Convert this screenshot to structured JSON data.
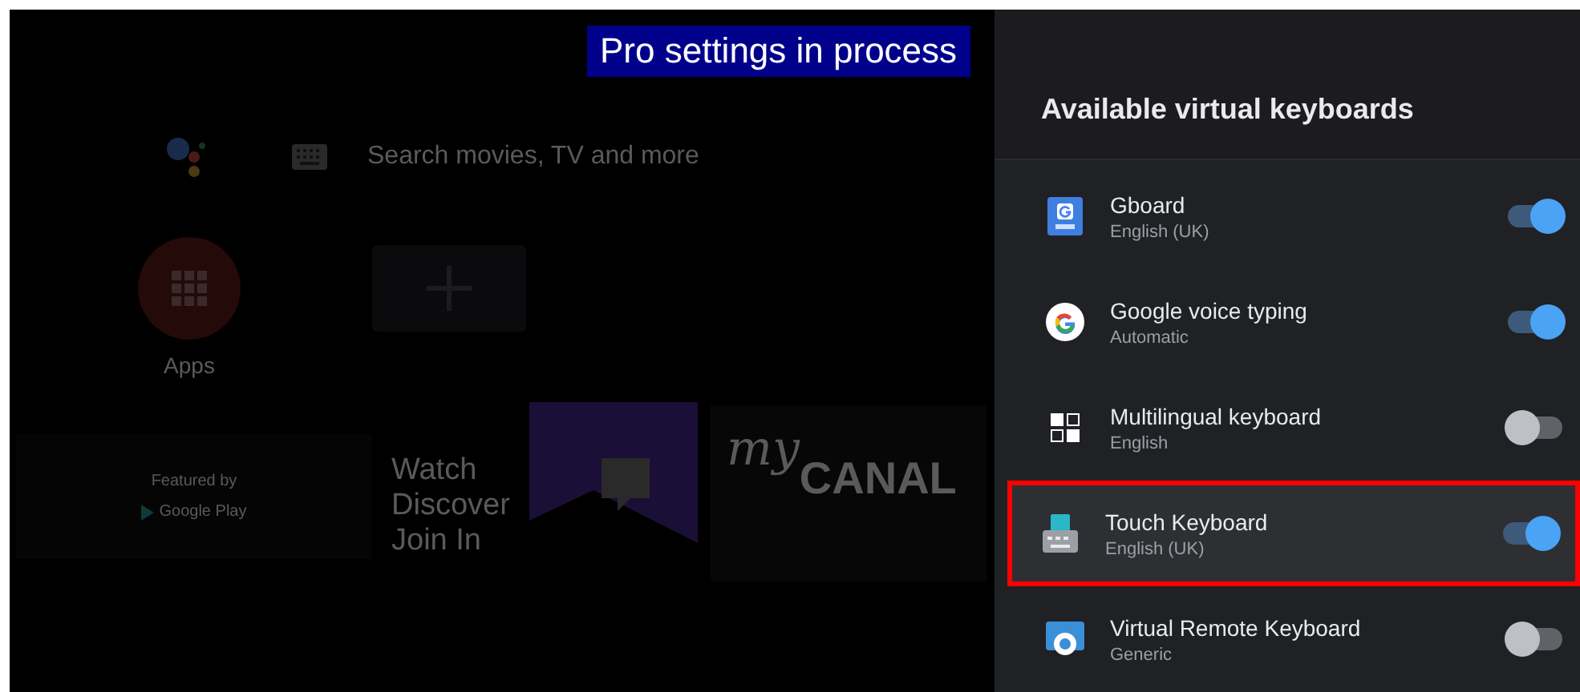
{
  "banner": {
    "text": "Pro settings in process"
  },
  "home": {
    "search": {
      "placeholder": "Search movies, TV and more"
    },
    "apps_label": "Apps",
    "cards": [
      {
        "kind": "featured",
        "lines": [
          "Featured by",
          "Google Play"
        ]
      },
      {
        "kind": "twitch",
        "lines": [
          "Watch",
          "Discover",
          "Join In"
        ]
      },
      {
        "kind": "canal",
        "lines": [
          "my",
          "CANAL"
        ]
      }
    ]
  },
  "panel": {
    "title": "Available virtual keyboards",
    "keyboards": [
      {
        "name": "Gboard",
        "subtitle": "English (UK)",
        "kind": "gboard",
        "on": true,
        "selected": false
      },
      {
        "name": "Google voice typing",
        "subtitle": "Automatic",
        "kind": "google",
        "on": true,
        "selected": false
      },
      {
        "name": "Multilingual keyboard",
        "subtitle": "English",
        "kind": "multilingual",
        "on": false,
        "selected": false
      },
      {
        "name": "Touch Keyboard",
        "subtitle": "English (UK)",
        "kind": "touch",
        "on": true,
        "selected": true
      },
      {
        "name": "Virtual Remote Keyboard",
        "subtitle": "Generic",
        "kind": "remote",
        "on": false,
        "selected": false
      }
    ]
  }
}
